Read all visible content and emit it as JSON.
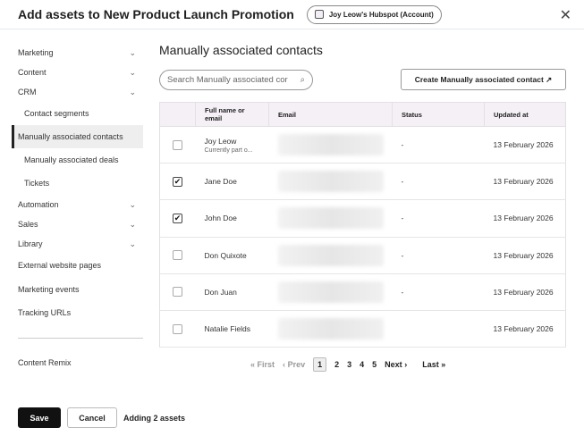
{
  "header": {
    "title": "Add assets to New Product Launch Promotion",
    "account": "Joy Leow's Hubspot (Account)"
  },
  "sidebar": {
    "items": [
      {
        "label": "Marketing",
        "chevron": true
      },
      {
        "label": "Content",
        "chevron": true
      },
      {
        "label": "CRM",
        "chevron": true
      },
      {
        "label": "Contact segments",
        "sub": true
      },
      {
        "label": "Manually associated contacts",
        "sub": true,
        "active": true
      },
      {
        "label": "Manually associated deals",
        "sub": true
      },
      {
        "label": "Tickets",
        "sub": true
      },
      {
        "label": "Automation",
        "chevron": true
      },
      {
        "label": "Sales",
        "chevron": true
      },
      {
        "label": "Library",
        "chevron": true
      },
      {
        "label": "External website pages"
      },
      {
        "label": "Marketing events"
      },
      {
        "label": "Tracking URLs"
      }
    ],
    "bottom": "Content Remix"
  },
  "main": {
    "title": "Manually associated contacts",
    "search_placeholder": "Search Manually associated cor",
    "create_label": "Create Manually associated contact"
  },
  "table": {
    "headers": [
      "Full name or email",
      "Email",
      "Status",
      "Updated at"
    ],
    "rows": [
      {
        "name": "Joy Leow",
        "sub": "Currently part o...",
        "status": "-",
        "updated": "13 February 2026",
        "checked": false
      },
      {
        "name": "Jane Doe",
        "status": "-",
        "updated": "13 February 2026",
        "checked": true
      },
      {
        "name": "John Doe",
        "status": "-",
        "updated": "13 February 2026",
        "checked": true
      },
      {
        "name": "Don Quixote",
        "status": "-",
        "updated": "13 February 2026",
        "checked": false
      },
      {
        "name": "Don Juan",
        "status": "-",
        "updated": "13 February 2026",
        "checked": false
      },
      {
        "name": "Natalie Fields",
        "status": "",
        "updated": "13 February 2026",
        "checked": false
      }
    ]
  },
  "pagination": {
    "first": "First",
    "prev": "Prev",
    "pages": [
      "1",
      "2",
      "3",
      "4",
      "5"
    ],
    "current": "1",
    "next": "Next",
    "last": "Last"
  },
  "footer": {
    "save": "Save",
    "cancel": "Cancel",
    "status": "Adding 2 assets"
  }
}
